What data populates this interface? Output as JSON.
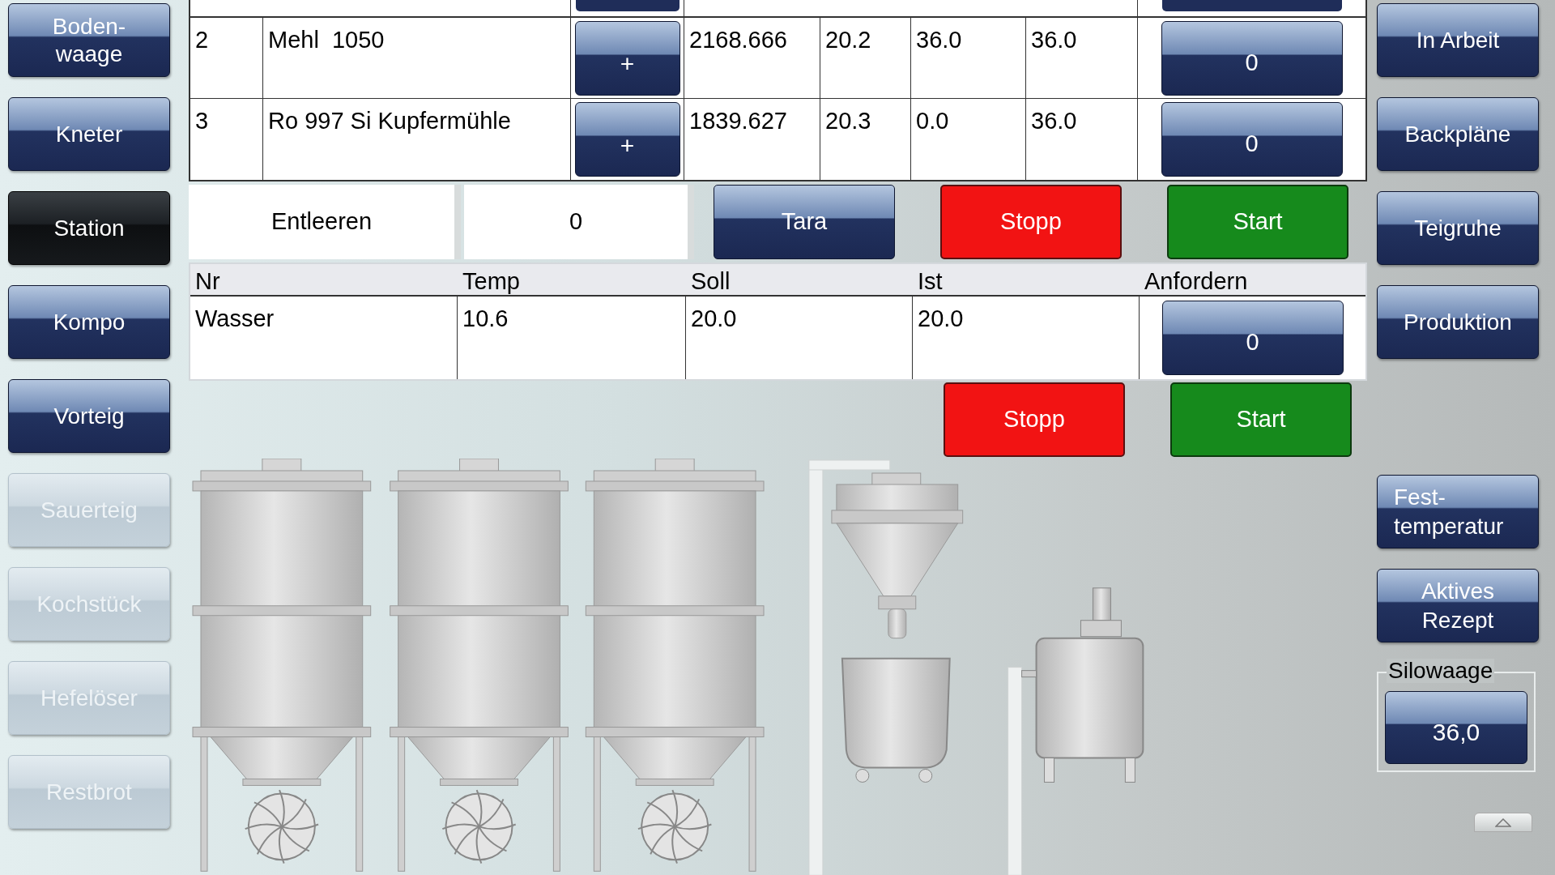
{
  "nav_left": [
    {
      "label": "Boden-\nwaage",
      "selected": false,
      "disabled": false
    },
    {
      "label": "Kneter",
      "selected": false,
      "disabled": false
    },
    {
      "label": "Station",
      "selected": true,
      "disabled": false
    },
    {
      "label": "Kompo",
      "selected": false,
      "disabled": false
    },
    {
      "label": "Vorteig",
      "selected": false,
      "disabled": false
    },
    {
      "label": "Sauerteig",
      "selected": false,
      "disabled": true
    },
    {
      "label": "Kochstück",
      "selected": false,
      "disabled": true
    },
    {
      "label": "Hefelöser",
      "selected": false,
      "disabled": true
    },
    {
      "label": "Restbrot",
      "selected": false,
      "disabled": true
    }
  ],
  "materials_table": {
    "rows": [
      {
        "nr": "2",
        "name": "Mehl  1050",
        "add": "+",
        "column_4": "2168.666",
        "column_5": "20.2",
        "column_6": "36.0",
        "column_7": "36.0",
        "request": "0"
      },
      {
        "nr": "3",
        "name": "Ro 997 Si Kupfermühle",
        "add": "+",
        "column_4": "1839.627",
        "column_5": "20.3",
        "column_6": "0.0",
        "column_7": "36.0",
        "request": "0"
      }
    ]
  },
  "actions": {
    "label": "Entleeren",
    "value": "0",
    "buttons": [
      {
        "label": "Tara",
        "kind": "neutral"
      },
      {
        "label": "Stopp",
        "kind": "stop"
      },
      {
        "label": "Start",
        "kind": "start"
      }
    ]
  },
  "water_table": {
    "columns": [
      "Nr",
      "Temp",
      "Soll",
      "Ist",
      "Anfordern"
    ],
    "rows": [
      {
        "cells": [
          "Wasser",
          "10.6",
          "20.0",
          "20.0"
        ],
        "request": "0"
      }
    ]
  },
  "water_controls": [
    {
      "label": "Stopp",
      "kind": "stop"
    },
    {
      "label": "Start",
      "kind": "start"
    }
  ],
  "nav_right": [
    {
      "label": "In Arbeit"
    },
    {
      "label": "Backpläne"
    },
    {
      "label": "Teigruhe"
    },
    {
      "label": "Produktion"
    }
  ],
  "nav_right_lower": [
    {
      "label": "Fest-\ntemperatur"
    },
    {
      "label": "Aktives\nRezept"
    }
  ],
  "silowaage": {
    "label": "Silowaage",
    "value": "36,0"
  }
}
